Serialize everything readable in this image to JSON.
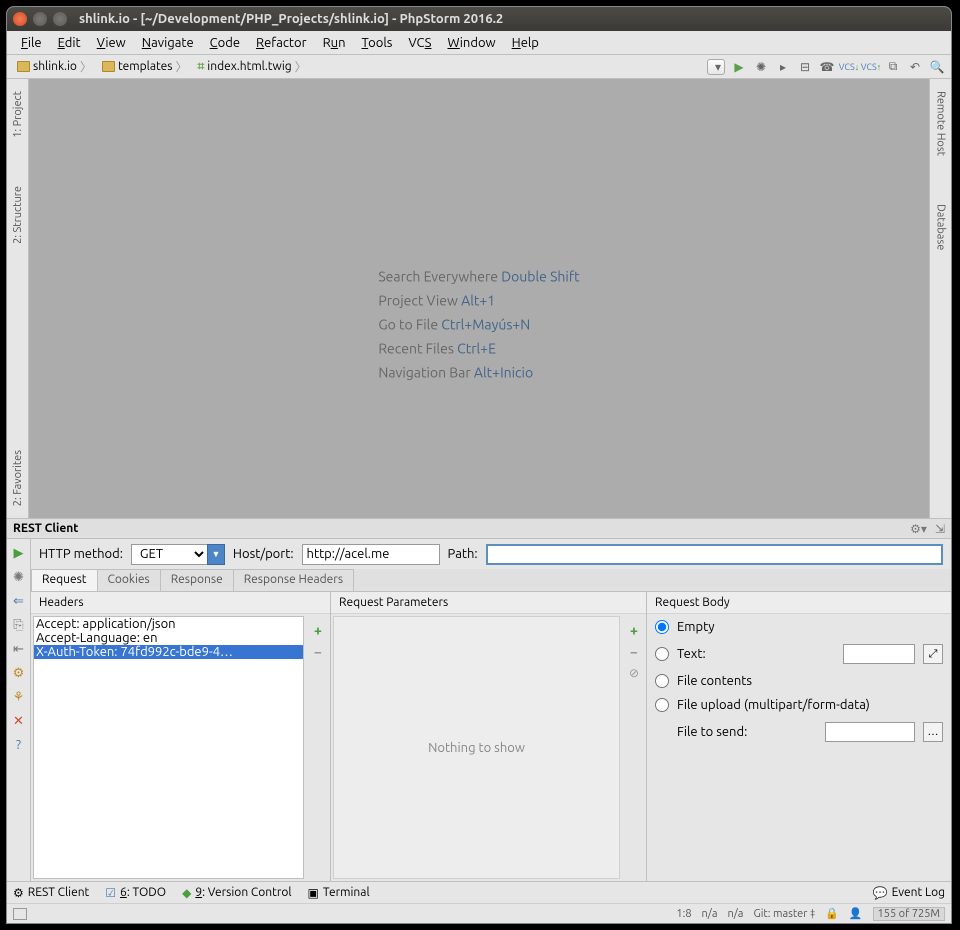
{
  "title": "shlink.io - [~/Development/PHP_Projects/shlink.io] - PhpStorm 2016.2",
  "menu": [
    "File",
    "Edit",
    "View",
    "Navigate",
    "Code",
    "Refactor",
    "Run",
    "Tools",
    "VCS",
    "Window",
    "Help"
  ],
  "breadcrumbs": [
    {
      "icon": "folder",
      "label": "shlink.io"
    },
    {
      "icon": "folder",
      "label": "templates"
    },
    {
      "icon": "twig",
      "label": "index.html.twig"
    }
  ],
  "leftTabs": [
    "1: Project",
    "2: Structure"
  ],
  "rightTabs": [
    "Remote Host",
    "Database"
  ],
  "leftLowerTabs": [
    "2: Favorites"
  ],
  "hints": [
    {
      "label": "Search Everywhere",
      "shortcut": "Double Shift"
    },
    {
      "label": "Project View",
      "shortcut": "Alt+1"
    },
    {
      "label": "Go to File",
      "shortcut": "Ctrl+Mayús+N"
    },
    {
      "label": "Recent Files",
      "shortcut": "Ctrl+E"
    },
    {
      "label": "Navigation Bar",
      "shortcut": "Alt+Inicio"
    }
  ],
  "rest": {
    "title": "REST Client",
    "method_label": "HTTP method:",
    "method_value": "GET",
    "host_label": "Host/port:",
    "host_value": "http://acel.me",
    "path_label": "Path:",
    "path_value": "",
    "tabs": [
      "Request",
      "Cookies",
      "Response",
      "Response Headers"
    ],
    "active_tab": 0,
    "headers_title": "Headers",
    "headers": [
      "Accept: application/json",
      "Accept-Language: en",
      "X-Auth-Token: 74fd992c-bde9-4…"
    ],
    "headers_selected": 2,
    "params_title": "Request Parameters",
    "params_empty": "Nothing to show",
    "body_title": "Request Body",
    "body_opts": {
      "empty": "Empty",
      "text": "Text:",
      "filecontents": "File contents",
      "fileupload": "File upload (multipart/form-data)",
      "filetosend": "File to send:"
    },
    "body_selected": "empty"
  },
  "footer_tabs": [
    "REST Client",
    "6: TODO",
    "9: Version Control",
    "Terminal"
  ],
  "event_log": "Event Log",
  "status": {
    "pos": "1:8",
    "enc1": "n/a",
    "enc2": "n/a",
    "git": "Git: master ‡",
    "mem": "155 of 725M"
  },
  "vcs_label": "VCS"
}
